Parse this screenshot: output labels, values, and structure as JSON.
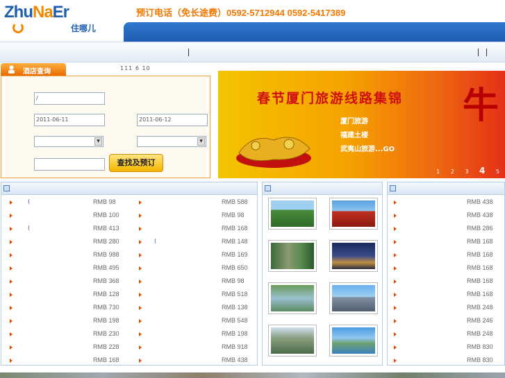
{
  "header": {
    "logo_text_1": "Zhu",
    "logo_text_2": "Na",
    "logo_text_3": "Er",
    "logo_cn": "住哪儿",
    "phone": "预订电话（免长途费）0592-5712944  0592-5417389"
  },
  "search": {
    "tab_label": "酒店查询",
    "notice": "111 6 10",
    "city_value": "/",
    "checkin_value": "2011-06-11",
    "checkout_value": "2011-06-12",
    "button_label": "查找及预订"
  },
  "banner": {
    "title": "春节厦门旅游线路集锦",
    "lines": [
      "厦门旅游",
      "福建土楼",
      "武夷山旅游...GO"
    ],
    "big_char": "牛",
    "pages": [
      "1",
      "2",
      "3",
      "4",
      "5"
    ],
    "current_page": "4"
  },
  "left_list": {
    "col1": [
      {
        "name": "(",
        "price": "RMB 98"
      },
      {
        "name": "",
        "price": "RMB 100"
      },
      {
        "name": "(",
        "price": "RMB 413"
      },
      {
        "name": "",
        "price": "RMB 280"
      },
      {
        "name": "",
        "price": "RMB 988"
      },
      {
        "name": "",
        "price": "RMB 495"
      },
      {
        "name": "",
        "price": "RMB 368"
      },
      {
        "name": "",
        "price": "RMB 128"
      },
      {
        "name": "",
        "price": "RMB 730"
      },
      {
        "name": "",
        "price": "RMB 198"
      },
      {
        "name": "",
        "price": "RMB 230"
      },
      {
        "name": "",
        "price": "RMB 228"
      },
      {
        "name": "",
        "price": "RMB 168"
      }
    ],
    "col2": [
      {
        "name": "",
        "price": "RMB 588"
      },
      {
        "name": "",
        "price": "RMB 98"
      },
      {
        "name": "",
        "price": "RMB 168"
      },
      {
        "name": "(",
        "price": "RMB 148"
      },
      {
        "name": "",
        "price": "RMB 169"
      },
      {
        "name": "",
        "price": "RMB 650"
      },
      {
        "name": "",
        "price": "RMB 98"
      },
      {
        "name": "",
        "price": "RMB 518"
      },
      {
        "name": "",
        "price": "RMB 138"
      },
      {
        "name": "",
        "price": "RMB 548"
      },
      {
        "name": "",
        "price": "RMB 198"
      },
      {
        "name": "",
        "price": "RMB 918"
      },
      {
        "name": "",
        "price": "RMB 438"
      }
    ]
  },
  "right_list": [
    {
      "price": "RMB 438"
    },
    {
      "price": "RMB 438"
    },
    {
      "price": "RMB 286"
    },
    {
      "price": "RMB 168"
    },
    {
      "price": "RMB 168"
    },
    {
      "price": "RMB 168"
    },
    {
      "price": "RMB 168"
    },
    {
      "price": "RMB 168"
    },
    {
      "price": "RMB 248"
    },
    {
      "price": "RMB 246"
    },
    {
      "price": "RMB 248"
    },
    {
      "price": "RMB 830"
    },
    {
      "price": "RMB 830"
    }
  ],
  "colors": {
    "accent_orange": "#f07800",
    "header_blue": "#1d5cb0",
    "price_text": "#666666"
  }
}
